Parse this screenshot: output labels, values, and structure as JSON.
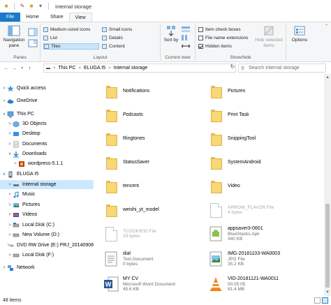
{
  "window": {
    "title": "Internal storage"
  },
  "ribbon_tabs": [
    {
      "label": "File"
    },
    {
      "label": "Home"
    },
    {
      "label": "Share"
    },
    {
      "label": "View"
    }
  ],
  "ribbon": {
    "panes_group": {
      "label": "Panes",
      "navigation_pane": "Navigation pane"
    },
    "layout_group": {
      "label": "Layout",
      "options": [
        "Medium-sized icons",
        "Small icons",
        "List",
        "Details",
        "Tiles",
        "Content"
      ],
      "selected": "Tiles"
    },
    "current_view_group": {
      "label": "Current view",
      "sort_by": "Sort by"
    },
    "show_hide_group": {
      "label": "Show/hide",
      "checkboxes": [
        {
          "label": "Item check boxes",
          "checked": false
        },
        {
          "label": "File name extensions",
          "checked": false
        },
        {
          "label": "Hidden items",
          "checked": true
        }
      ],
      "hide_selected": "Hide selected items"
    },
    "options": "Options"
  },
  "address": {
    "crumbs": [
      "This PC",
      "ELUGA I5",
      "Internal storage"
    ],
    "search_placeholder": "Search Internal storage"
  },
  "nav_pane": [
    {
      "label": "Quick access",
      "icon": "star-icon",
      "chev": ">"
    },
    {
      "label": "OneDrive",
      "icon": "cloud-icon",
      "chev": ">"
    },
    {
      "label": "This PC",
      "icon": "pc-icon",
      "chev": "v"
    },
    {
      "label": "3D Objects",
      "icon": "cube-icon",
      "chev": ">"
    },
    {
      "label": "Desktop",
      "icon": "desktop-icon",
      "chev": ">"
    },
    {
      "label": "Documents",
      "icon": "documents-icon",
      "chev": ">"
    },
    {
      "label": "Downloads",
      "icon": "download-icon",
      "chev": "v"
    },
    {
      "label": "wordpress-5.1.1",
      "icon": "archive-icon",
      "chev": ">"
    },
    {
      "label": "ELUGA I5",
      "icon": "phone-icon",
      "chev": "v"
    },
    {
      "label": "Internal storage",
      "icon": "drive-icon",
      "chev": ">"
    },
    {
      "label": "Music",
      "icon": "music-icon",
      "chev": ">"
    },
    {
      "label": "Pictures",
      "icon": "pictures-icon",
      "chev": ">"
    },
    {
      "label": "Videos",
      "icon": "videos-icon",
      "chev": ">"
    },
    {
      "label": "Local Disk (C:)",
      "icon": "disk-icon",
      "chev": ">"
    },
    {
      "label": "New Volume (D:)",
      "icon": "disk-icon",
      "chev": ">"
    },
    {
      "label": "DVD RW Drive (E:) PRJ_20140908",
      "icon": "dvd-icon",
      "chev": ">"
    },
    {
      "label": "Local Disk (F:)",
      "icon": "disk-icon",
      "chev": ">"
    },
    {
      "label": "Network",
      "icon": "network-icon",
      "chev": ">"
    }
  ],
  "items": [
    {
      "name": "Notifications",
      "type": "folder"
    },
    {
      "name": "Pictures",
      "type": "folder"
    },
    {
      "name": "Podcasts",
      "type": "folder"
    },
    {
      "name": "Print Task",
      "type": "folder"
    },
    {
      "name": "Ringtones",
      "type": "folder"
    },
    {
      "name": "SnippingTool",
      "type": "folder"
    },
    {
      "name": "StatusSaver",
      "type": "folder"
    },
    {
      "name": "SystemAndroid",
      "type": "folder"
    },
    {
      "name": "tencent",
      "type": "folder"
    },
    {
      "name": "Video",
      "type": "folder"
    },
    {
      "name": "weishi_yt_model",
      "type": "folder"
    },
    {
      "name": "",
      "sub1": "ARROW_FLAVOR File",
      "sub2": "4 bytes",
      "type": "file",
      "faded": true
    },
    {
      "name": "",
      "sub1": "TCOOKIEID File",
      "sub2": "33 bytes",
      "type": "file",
      "faded": true
    },
    {
      "name": "appsaver3-0601",
      "sub1": "BlueStacks.Apk",
      "sub2": "340 KB",
      "type": "apk"
    },
    {
      "name": "dial",
      "sub1": "Text Document",
      "sub2": "0 bytes",
      "type": "text"
    },
    {
      "name": "IMG-20181103-WA0003",
      "sub1": "JPG File",
      "sub2": "35.2 KB",
      "type": "image"
    },
    {
      "name": "MY CV",
      "sub1": "Microsoft Word Document",
      "sub2": "45.6 KB",
      "type": "word"
    },
    {
      "name": "VID-20181121-WA0011",
      "sub1": "00:05:05",
      "sub2": "81.4 MB",
      "type": "video"
    }
  ],
  "status": {
    "count": "48 items"
  },
  "colors": {
    "file_tab": "#1979ca",
    "selection": "#cce8ff",
    "folder": "#f8d775"
  }
}
